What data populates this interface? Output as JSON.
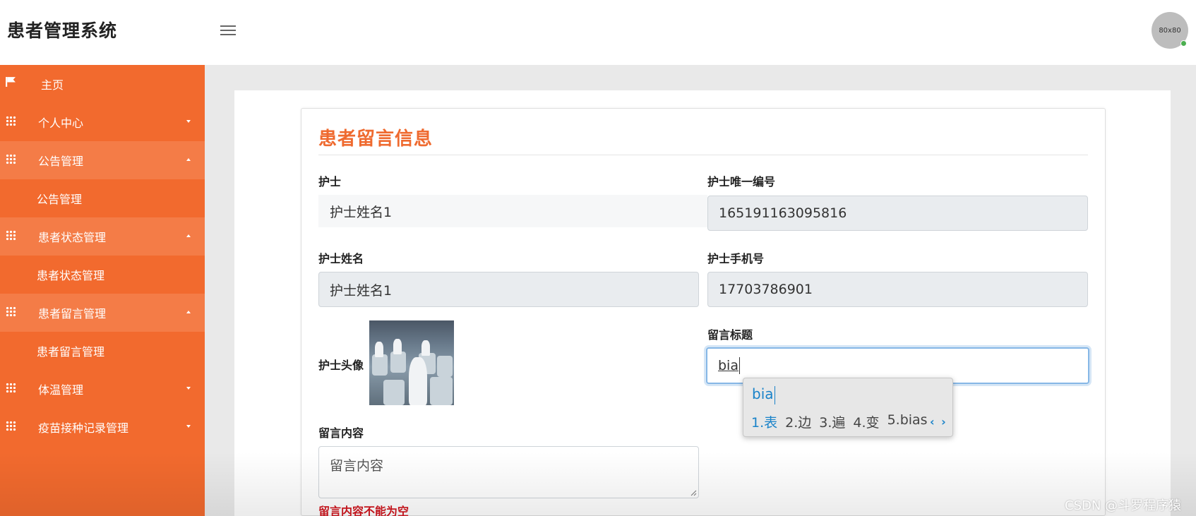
{
  "header": {
    "app_title": "患者管理系统",
    "avatar_text": "80x80"
  },
  "sidebar": {
    "items": [
      {
        "label": "主页",
        "icon": "flag-icon"
      },
      {
        "label": "个人中心",
        "icon": "grid-icon",
        "state": "collapsed"
      },
      {
        "label": "公告管理",
        "icon": "grid-icon",
        "state": "expanded"
      },
      {
        "label": "公告管理",
        "sub": true
      },
      {
        "label": "患者状态管理",
        "icon": "grid-icon",
        "state": "expanded"
      },
      {
        "label": "患者状态管理",
        "sub": true
      },
      {
        "label": "患者留言管理",
        "icon": "grid-icon",
        "state": "expanded"
      },
      {
        "label": "患者留言管理",
        "sub": true
      },
      {
        "label": "体温管理",
        "icon": "grid-icon",
        "state": "collapsed"
      },
      {
        "label": "疫苗接种记录管理",
        "icon": "grid-icon",
        "state": "collapsed"
      }
    ]
  },
  "form": {
    "title": "患者留言信息",
    "nurse_label": "护士",
    "nurse_value": "护士姓名1",
    "nurse_id_label": "护士唯一编号",
    "nurse_id_value": "165191163095816",
    "nurse_name_label": "护士姓名",
    "nurse_name_value": "护士姓名1",
    "nurse_phone_label": "护士手机号",
    "nurse_phone_value": "17703786901",
    "nurse_avatar_label": "护士头像",
    "message_title_label": "留言标题",
    "message_title_value": "bia",
    "message_content_label": "留言内容",
    "message_content_placeholder": "留言内容",
    "message_content_error": "留言内容不能为空"
  },
  "ime": {
    "composition": "bia",
    "candidates": [
      "1.表",
      "2.边",
      "3.遍",
      "4.变",
      "5.bias"
    ],
    "nav": "‹ ›"
  },
  "watermark": "CSDN @斗罗程序猿",
  "colors": {
    "accent": "#f26a2e",
    "title": "#ef6a2f",
    "error": "#d0161e",
    "ime_highlight": "#1a83c9"
  }
}
